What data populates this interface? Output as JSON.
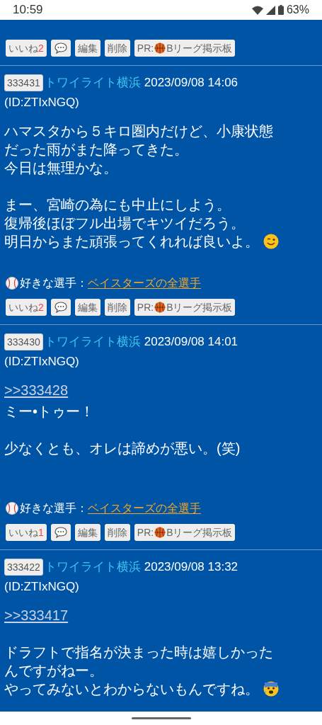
{
  "status_bar": {
    "time": "10:59",
    "battery": "63%"
  },
  "top_fragment": {
    "buttons": {
      "like": "いいね",
      "like_count": "2",
      "edit": "編集",
      "delete": "削除",
      "pr_prefix": "PR:",
      "pr_label": "Bリーグ掲示板"
    }
  },
  "posts": [
    {
      "number": "333431",
      "author": "トワイライト横浜",
      "date": "2023/09/08 14:06",
      "id": "(ID:ZTIxNGQ)",
      "blocks": [
        {
          "kind": "text",
          "lines": [
            {
              "text": "ハマスタから５キロ圏内だけど、小康状態",
              "kind": "plain"
            },
            {
              "text": "だった雨がまた降ってきた。",
              "kind": "plain"
            },
            {
              "text": "今日は無理かな。",
              "kind": "plain"
            }
          ]
        },
        {
          "kind": "text",
          "lines": [
            {
              "text": "まー、宮崎の為にも中止にしよう。",
              "kind": "plain"
            },
            {
              "text": "復帰後ほぼフル出場でキツイだろう。",
              "kind": "plain"
            },
            {
              "text": "明日からまた頑張ってくれれば良いよ。",
              "kind": "wink"
            }
          ]
        }
      ],
      "fav_label": "好きな選手：",
      "fav_link": "ベイスターズの全選手",
      "buttons": {
        "like": "いいね",
        "like_count": "2",
        "edit": "編集",
        "delete": "削除",
        "pr_prefix": "PR:",
        "pr_label": "Bリーグ掲示板"
      }
    },
    {
      "number": "333430",
      "author": "トワイライト横浜",
      "date": "2023/09/08 14:01",
      "id": "(ID:ZTIxNGQ)",
      "blocks": [
        {
          "kind": "reply",
          "text": ">>333428"
        },
        {
          "kind": "text",
          "lines": [
            {
              "text": "ミー•トゥー！",
              "kind": "plain"
            }
          ]
        },
        {
          "kind": "text",
          "lines": [
            {
              "text": "少なくとも、オレは諦めが悪い。(笑)",
              "kind": "plain"
            }
          ]
        }
      ],
      "fav_label": "好きな選手：",
      "fav_link": "ベイスターズの全選手",
      "buttons": {
        "like": "いいね",
        "like_count": "1",
        "edit": "編集",
        "delete": "削除",
        "pr_prefix": "PR:",
        "pr_label": "Bリーグ掲示板"
      }
    },
    {
      "number": "333422",
      "author": "トワイライト横浜",
      "date": "2023/09/08 13:32",
      "id": "(ID:ZTIxNGQ)",
      "blocks": [
        {
          "kind": "reply",
          "text": ">>333417"
        },
        {
          "kind": "text",
          "lines": [
            {
              "text": "ドラフトで指名が決まった時は嬉しかった",
              "kind": "plain"
            },
            {
              "text": "んですがねー。",
              "kind": "plain"
            },
            {
              "text": "やってみないとわからないもんですね。",
              "kind": "anxious"
            }
          ],
          "gap": true
        }
      ]
    }
  ]
}
